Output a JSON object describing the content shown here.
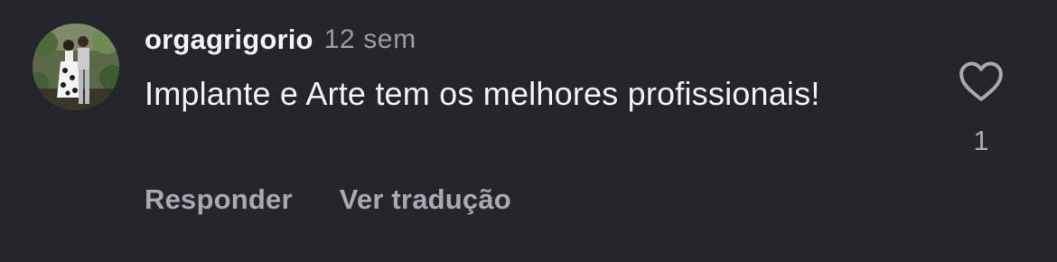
{
  "comment": {
    "username": "orgagrigorio",
    "timestamp": "12 sem",
    "text": "Implante e Arte tem os melhores profissionais!",
    "reply_label": "Responder",
    "translate_label": "Ver tradução",
    "like_count": "1",
    "like_icon": "heart-outline-icon",
    "avatar": "profile-photo"
  },
  "colors": {
    "background": "#24262b",
    "primary_text": "#f2f3f5",
    "secondary_text": "#a7a9b0"
  }
}
